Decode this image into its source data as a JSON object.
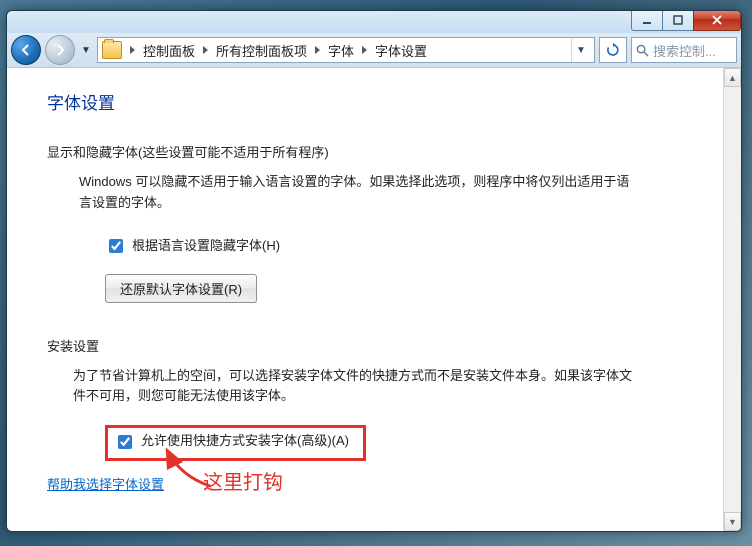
{
  "titlebar": {
    "min_tip": "最小化",
    "max_tip": "最大化",
    "close_tip": "关闭"
  },
  "nav": {
    "back_tip": "后退",
    "forward_tip": "前进"
  },
  "breadcrumb": {
    "items": [
      "控制面板",
      "所有控制面板项",
      "字体",
      "字体设置"
    ]
  },
  "search": {
    "placeholder": "搜索控制..."
  },
  "page": {
    "title": "字体设置",
    "section1": {
      "title": "显示和隐藏字体(这些设置可能不适用于所有程序)",
      "desc": "Windows 可以隐藏不适用于输入语言设置的字体。如果选择此选项，则程序中将仅列出适用于语言设置的字体。",
      "checkbox_label": "根据语言设置隐藏字体(H)",
      "checkbox_checked": true,
      "button_label": "还原默认字体设置(R)"
    },
    "section2": {
      "title": "安装设置",
      "desc": "为了节省计算机上的空间，可以选择安装字体文件的快捷方式而不是安装文件本身。如果该字体文件不可用，则您可能无法使用该字体。",
      "checkbox_label": "允许使用快捷方式安装字体(高级)(A)",
      "checkbox_checked": true
    },
    "help_link": "帮助我选择字体设置"
  },
  "annotation": {
    "text": "这里打钩"
  }
}
